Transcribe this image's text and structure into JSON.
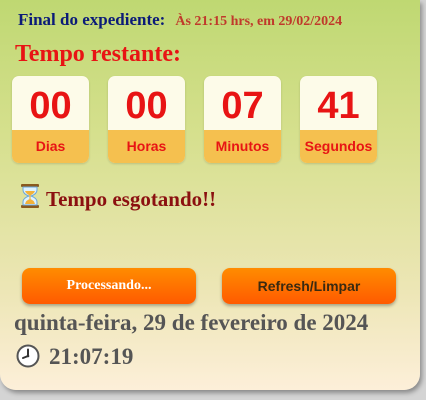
{
  "header": {
    "label": "Final do expediente:",
    "value": "Às 21:15 hrs, em 29/02/2024"
  },
  "countdown": {
    "title": "Tempo restante:",
    "units": [
      {
        "value": "00",
        "label": "Dias"
      },
      {
        "value": "00",
        "label": "Horas"
      },
      {
        "value": "07",
        "label": "Minutos"
      },
      {
        "value": "41",
        "label": "Segundos"
      }
    ]
  },
  "status": {
    "icon": "hourglass-icon",
    "text": "Tempo esgotando!!"
  },
  "buttons": {
    "processing_label": "Processando...",
    "refresh_label": "Refresh/Limpar"
  },
  "current": {
    "date": "quinta-feira, 29 de fevereiro de 2024",
    "clock_icon": "clock-icon",
    "time": "21:07:19"
  },
  "colors": {
    "accent_red": "#e81414",
    "label_band": "#f5c04f",
    "button_orange": "#ff6a00",
    "header_blue": "#0b1b78"
  }
}
